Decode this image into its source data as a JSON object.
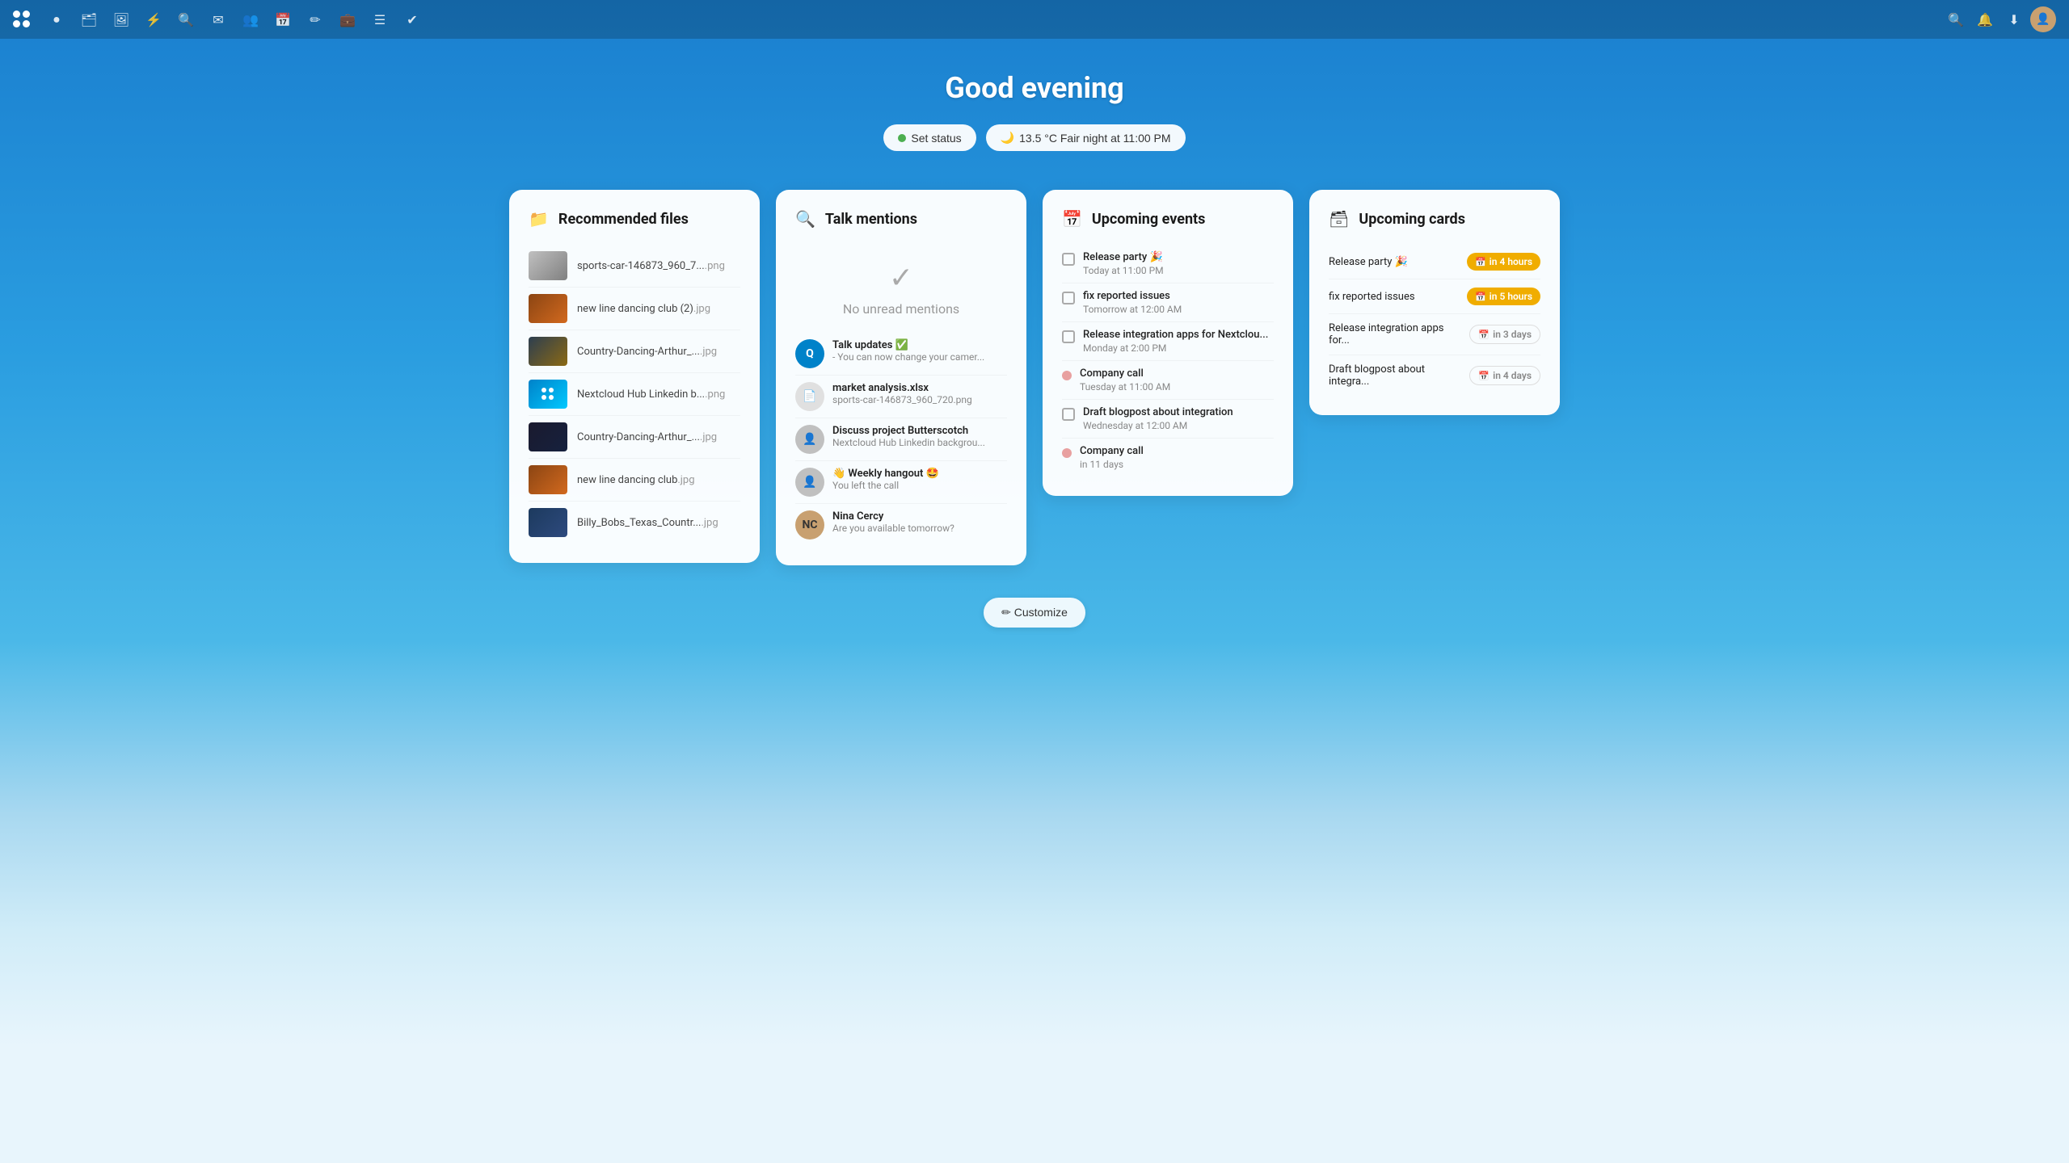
{
  "topbar": {
    "icons": [
      "circle",
      "folder",
      "image",
      "lightning",
      "search",
      "mail",
      "people",
      "calendar",
      "pencil",
      "briefcase",
      "list",
      "checkmark"
    ]
  },
  "greeting": "Good evening",
  "status": {
    "set_status_label": "Set status",
    "weather_label": "13.5 °C Fair night at 11:00 PM",
    "weather_icon": "🌙"
  },
  "panels": {
    "recommended_files": {
      "title": "Recommended files",
      "files": [
        {
          "name": "sports-car-146873_960_7...",
          "ext": ".png",
          "thumb": "car"
        },
        {
          "name": "new line dancing club (2)",
          "ext": ".jpg",
          "thumb": "dance1"
        },
        {
          "name": "Country-Dancing-Arthur_...",
          "ext": ".jpg",
          "thumb": "dance2"
        },
        {
          "name": "Nextcloud Hub Linkedin b...",
          "ext": ".png",
          "thumb": "nc"
        },
        {
          "name": "Country-Dancing-Arthur_...",
          "ext": ".jpg",
          "thumb": "dance3"
        },
        {
          "name": "new line dancing club",
          "ext": ".jpg",
          "thumb": "dance4"
        },
        {
          "name": "Billy_Bobs_Texas_Countr...",
          "ext": ".jpg",
          "thumb": "billy"
        }
      ]
    },
    "talk_mentions": {
      "title": "Talk mentions",
      "no_mentions_text": "No unread mentions",
      "mentions": [
        {
          "title": "Talk updates ✅",
          "sub": "- You can now change your camer...",
          "type": "blue_circle"
        },
        {
          "title": "market analysis.xlsx",
          "sub": "sports-car-146873_960_720.png",
          "type": "doc"
        },
        {
          "title": "Discuss project Butterscotch",
          "sub": "Nextcloud Hub Linkedin backgrou...",
          "type": "gray_person"
        },
        {
          "title": "👋 Weekly hangout 🤩",
          "sub": "You left the call",
          "type": "light_gray_person"
        },
        {
          "title": "Nina Cercy",
          "sub": "Are you available tomorrow?",
          "type": "avatar_photo"
        }
      ]
    },
    "upcoming_events": {
      "title": "Upcoming events",
      "events": [
        {
          "name": "Release party 🎉",
          "time": "Today at 11:00 PM",
          "type": "checkbox"
        },
        {
          "name": "fix reported issues",
          "time": "Tomorrow at 12:00 AM",
          "type": "checkbox"
        },
        {
          "name": "Release integration apps for Nextclou...",
          "time": "Monday at 2:00 PM",
          "type": "checkbox"
        },
        {
          "name": "Company call",
          "time": "Tuesday at 11:00 AM",
          "type": "dot_pink"
        },
        {
          "name": "Draft blogpost about integration",
          "time": "Wednesday at 12:00 AM",
          "type": "checkbox"
        },
        {
          "name": "Company call",
          "time": "in 11 days",
          "type": "dot_pink"
        }
      ]
    },
    "upcoming_cards": {
      "title": "Upcoming cards",
      "cards": [
        {
          "name": "Release party 🎉",
          "badge": "in 4 hours",
          "badge_type": "yellow"
        },
        {
          "name": "fix reported issues",
          "badge": "in 5 hours",
          "badge_type": "yellow"
        },
        {
          "name": "Release integration apps for...",
          "badge": "in 3 days",
          "badge_type": "gray"
        },
        {
          "name": "Draft blogpost about integra...",
          "badge": "in 4 days",
          "badge_type": "gray"
        }
      ]
    }
  },
  "customize": {
    "label": "✏ Customize"
  }
}
